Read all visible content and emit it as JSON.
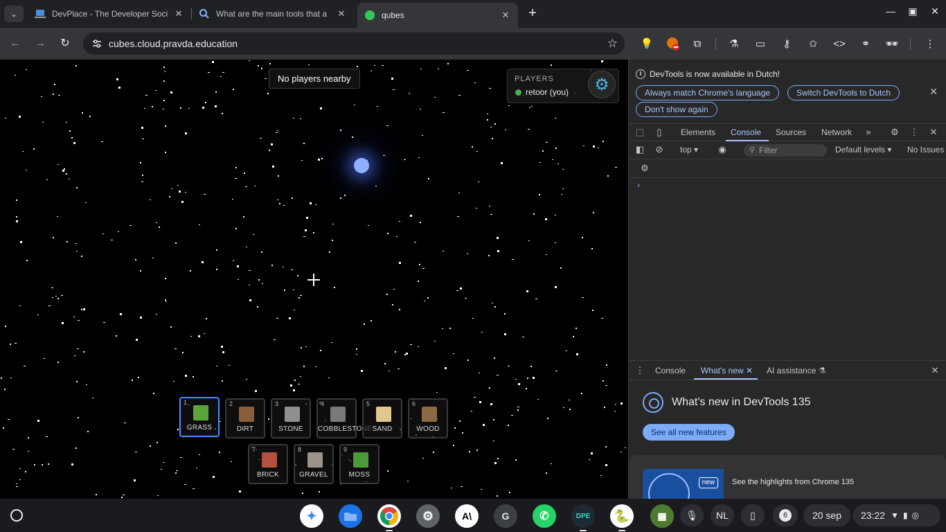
{
  "browser": {
    "tabs": [
      {
        "title": "DevPlace - The Developer Socia",
        "active": false
      },
      {
        "title": "What are the main tools that a",
        "active": false
      },
      {
        "title": "qubes",
        "active": true
      }
    ],
    "url": "cubes.cloud.pravda.education"
  },
  "game": {
    "nearby_text": "No players nearby",
    "players_header": "PLAYERS",
    "players": [
      {
        "name": "retoor (you)",
        "status_color": "#4caf50"
      }
    ],
    "hotbar": [
      {
        "num": "1",
        "label": "GRASS",
        "color": "#5aa63a",
        "selected": true
      },
      {
        "num": "2",
        "label": "DIRT",
        "color": "#8a5d3b",
        "selected": false
      },
      {
        "num": "3",
        "label": "STONE",
        "color": "#8f8f8f",
        "selected": false
      },
      {
        "num": "4",
        "label": "COBBLESTONE",
        "color": "#7a7a7a",
        "selected": false
      },
      {
        "num": "5",
        "label": "SAND",
        "color": "#e2c88e",
        "selected": false
      },
      {
        "num": "6",
        "label": "WOOD",
        "color": "#8b6a42",
        "selected": false
      },
      {
        "num": "7",
        "label": "BRICK",
        "color": "#b5503e",
        "selected": false
      },
      {
        "num": "8",
        "label": "GRAVEL",
        "color": "#9b948b",
        "selected": false
      },
      {
        "num": "9",
        "label": "MOSS",
        "color": "#4b9a3a",
        "selected": false
      }
    ]
  },
  "devtools": {
    "info_text": "DevTools is now available in Dutch!",
    "btn_match": "Always match Chrome's language",
    "btn_switch": "Switch DevTools to Dutch",
    "btn_dont_show": "Don't show again",
    "tabs": {
      "elements": "Elements",
      "console": "Console",
      "sources": "Sources",
      "network": "Network"
    },
    "console": {
      "context": "top",
      "filter_placeholder": "Filter",
      "levels": "Default levels",
      "issues": "No Issues"
    },
    "drawer": {
      "tab_console": "Console",
      "tab_whats_new": "What's new",
      "tab_ai": "AI assistance",
      "title": "What's new in DevTools 135",
      "button": "See all new features",
      "card_badge": "new",
      "card_text": "See the highlights from Chrome 135"
    }
  },
  "shelf": {
    "lang": "NL",
    "notifications": "6",
    "date": "20 sep",
    "time": "23:22"
  }
}
